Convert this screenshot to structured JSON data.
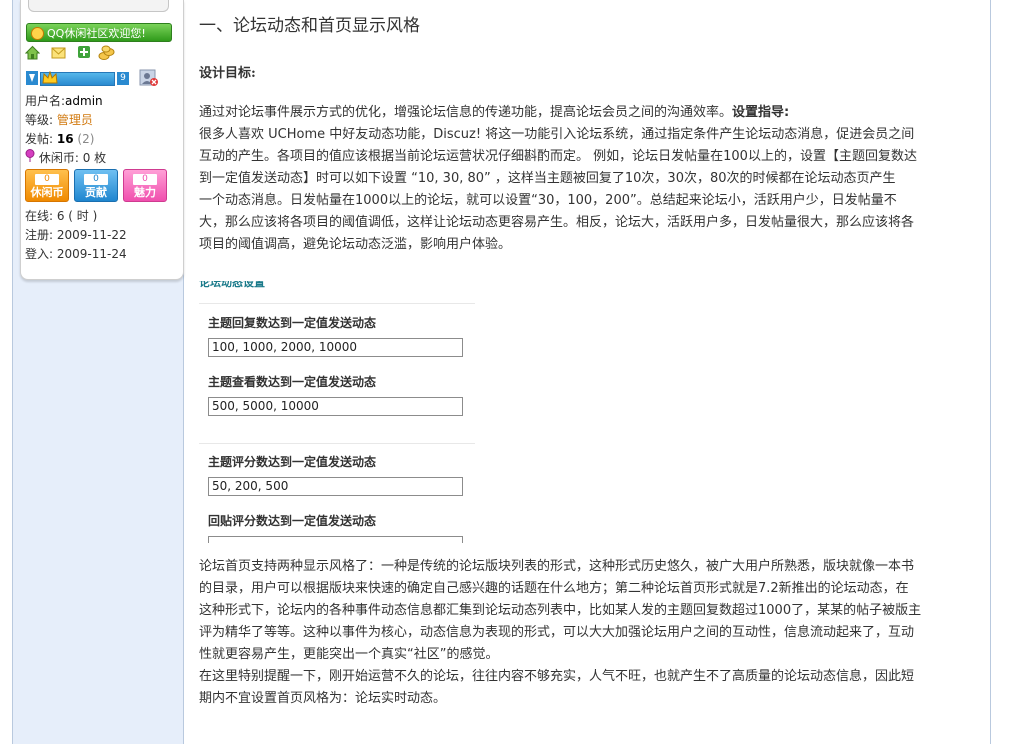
{
  "sidebar": {
    "welcome_banner": "QQ休闲社区欢迎您!",
    "level_number": "9",
    "username_label": "用户名:",
    "username": "admin",
    "group_label": "等级:",
    "group": "管理员",
    "posts_label": "发帖:",
    "posts": "16",
    "posts_extra": "(2)",
    "currency_label": "休闲币:",
    "currency_value": "0 枚",
    "badges": [
      {
        "value": "0",
        "label": "休闲币"
      },
      {
        "value": "0",
        "label": "贡献"
      },
      {
        "value": "0",
        "label": "魅力"
      }
    ],
    "online": "在线: 6 ( 时 )",
    "register": "注册: 2009-11-22",
    "login": "登入: 2009-11-24"
  },
  "article": {
    "title": "一、论坛动态和首页显示风格",
    "goal_heading": "设计目标:",
    "para1_lines": [
      "通过对论坛事件展示方式的优化，增强论坛信息的传递功能，提高论坛会员之间的沟通效率。",
      "很多人喜欢  UCHome 中好友动态功能，Discuz! 将这一功能引入论坛系统，通过指定条件产生论坛动态消息，促进会员之间",
      "互动的产生。各项目的值应该根据当前论坛运营状况仔细斟酌而定。  例如，论坛日发帖量在100以上的，设置【主题回复数达",
      "到一定值发送动态】时可以如下设置  “10, 30, 80”  ，这样当主题被回复了10次，30次，80次的时候都在论坛动态页产生",
      "一个动态消息。日发帖量在1000以上的论坛，就可以设置“30，100，200”。总结起来论坛小，活跃用户少，日发帖量不",
      "大，那么应该将各项目的阈值调低，这样让论坛动态更容易产生。相反，论坛大，活跃用户多，日发帖量很大，那么应该将各",
      "项目的阈值调高，避免论坛动态泛滥，影响用户体验。"
    ],
    "guide_label": "设置指导:",
    "settings": {
      "clipped_heading": "论坛动态设置",
      "items": [
        {
          "label": "主题回复数达到一定值发送动态",
          "value": "100, 1000, 2000, 10000"
        },
        {
          "label": "主题查看数达到一定值发送动态",
          "value": "500, 5000, 10000"
        },
        {
          "label": "主题评分数达到一定值发送动态",
          "value": "50, 200, 500"
        },
        {
          "label": "回贴评分数达到一定值发送动态",
          "value": ""
        }
      ]
    },
    "para2_lines": [
      "论坛首页支持两种显示风格了：一种是传统的论坛版块列表的形式，这种形式历史悠久，被广大用户所熟悉，版块就像一本书",
      "的目录，用户可以根据版块来快速的确定自己感兴趣的话题在什么地方；第二种论坛首页形式就是7.2新推出的论坛动态，在",
      "这种形式下，论坛内的各种事件动态信息都汇集到论坛动态列表中，比如某人发的主题回复数超过1000了，某某的帖子被版主",
      "评为精华了等等。这种以事件为核心，动态信息为表现的形式，可以大大加强论坛用户之间的互动性，信息流动起来了，互动",
      "性就更容易产生，更能突出一个真实“社区”的感觉。",
      "在这里特别提醒一下，刚开始运营不久的论坛，往往内容不够充实，人气不旺，也就产生不了高质量的论坛动态信息，因此短",
      "期内不宜设置首页风格为：论坛实时动态。"
    ]
  }
}
